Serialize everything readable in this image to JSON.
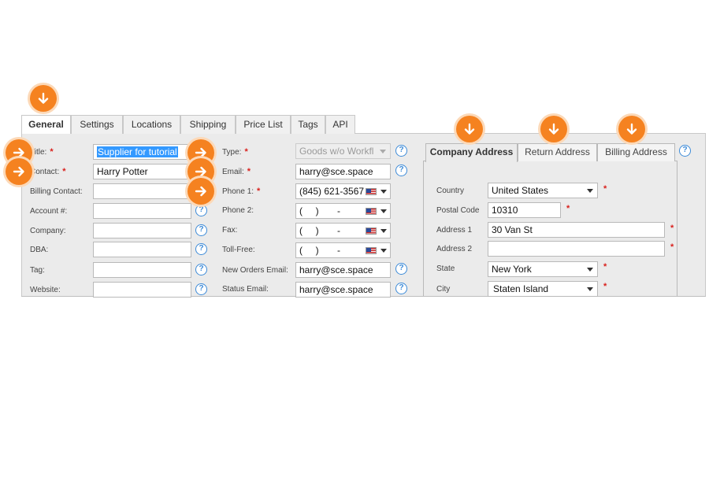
{
  "tabs": [
    "General",
    "Settings",
    "Locations",
    "Shipping",
    "Price List",
    "Tags",
    "API"
  ],
  "left_fields": {
    "title": {
      "label": "Title:",
      "value": "Supplier for tutorial"
    },
    "contact": {
      "label": "Contact:",
      "value": "Harry Potter"
    },
    "billing_contact": {
      "label": "Billing Contact:",
      "value": ""
    },
    "account": {
      "label": "Account #:",
      "value": ""
    },
    "company": {
      "label": "Company:",
      "value": ""
    },
    "dba": {
      "label": "DBA:",
      "value": ""
    },
    "tag": {
      "label": "Tag:",
      "value": ""
    },
    "website": {
      "label": "Website:",
      "value": ""
    }
  },
  "middle_fields": {
    "type": {
      "label": "Type:",
      "value": "Goods w/o Workfl"
    },
    "email": {
      "label": "Email:",
      "value": "harry@sce.space"
    },
    "phone1": {
      "label": "Phone 1:",
      "value": "(845) 621-3567"
    },
    "phone2": {
      "label": "Phone 2:",
      "value": "(     )       -"
    },
    "fax": {
      "label": "Fax:",
      "value": "(     )       -"
    },
    "tollfree": {
      "label": "Toll-Free:",
      "value": "(     )       -"
    },
    "new_orders_email": {
      "label": "New Orders Email:",
      "value": "harry@sce.space"
    },
    "status_email": {
      "label": "Status Email:",
      "value": "harry@sce.space"
    }
  },
  "address_tabs": [
    "Company Address",
    "Return Address",
    "Billing Address"
  ],
  "address_fields": {
    "country": {
      "label": "Country",
      "value": "United States"
    },
    "postal_code": {
      "label": "Postal Code",
      "value": "10310"
    },
    "address1": {
      "label": "Address 1",
      "value": "30 Van St"
    },
    "address2": {
      "label": "Address 2",
      "value": ""
    },
    "state": {
      "label": "State",
      "value": "New York"
    },
    "city": {
      "label": "City",
      "value": "Staten Island"
    }
  },
  "required_mark": "*",
  "help_glyph": "?",
  "colors": {
    "accent_orange": "#f58220",
    "help_blue": "#3d8bd8",
    "required_red": "#d9201c",
    "selection_blue": "#3399ff"
  },
  "icons": {
    "badge_down": "arrow-down-icon",
    "badge_right": "arrow-right-icon",
    "help": "question-circle-icon",
    "flag": "us-flag-icon"
  }
}
